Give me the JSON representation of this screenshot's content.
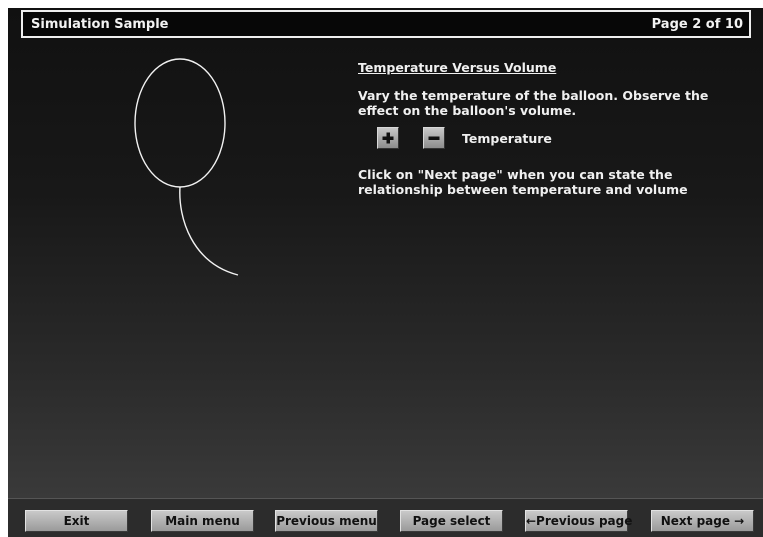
{
  "header": {
    "title": "Simulation Sample",
    "page_indicator": "Page 2 of 10"
  },
  "content": {
    "heading": "Temperature Versus Volume",
    "instruction_1": "Vary the temperature of the balloon. Observe the effect on the balloon's volume.",
    "control_label": "Temperature",
    "instruction_2": "Click on \"Next page\" when you can state the relationship between temperature and volume"
  },
  "icons": {
    "increase": "plus-icon",
    "decrease": "minus-icon"
  },
  "nav": {
    "exit": "Exit",
    "main_menu": "Main menu",
    "previous_menu": "Previous menu",
    "page_select": "Page select",
    "previous_page": "←Previous page",
    "next_page": "Next page →"
  },
  "colors": {
    "background_top": "#111111",
    "background_bottom": "#3c3c3c",
    "text": "#f0f0f0",
    "button_face": "#bbbbbb"
  }
}
